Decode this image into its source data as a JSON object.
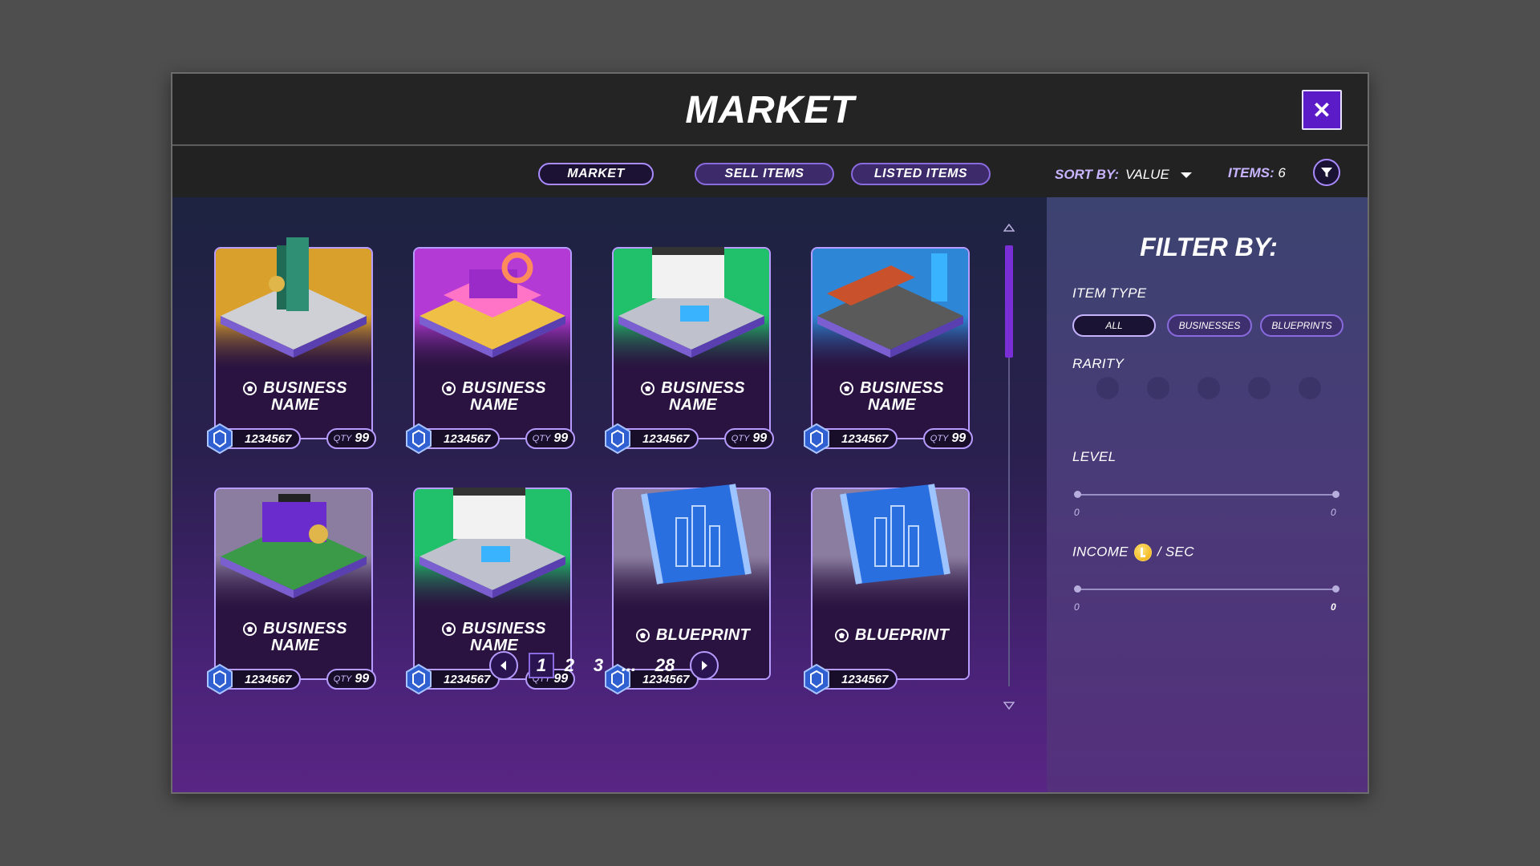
{
  "window": {
    "title": "MARKET",
    "close_label": "✕"
  },
  "tabs": [
    {
      "label": "MARKET",
      "active": true
    },
    {
      "label": "SELL ITEMS",
      "active": false
    },
    {
      "label": "LISTED ITEMS",
      "active": false
    }
  ],
  "sort": {
    "label": "SORT BY:",
    "value": "VALUE"
  },
  "items": {
    "label": "ITEMS:",
    "count": "6"
  },
  "cards": [
    {
      "name_line1": "BUSINESS",
      "name_line2": "NAME",
      "price": "1234567",
      "qty_label": "QTY",
      "qty": "99",
      "bg": "#d9a02b",
      "art": "tower-icon"
    },
    {
      "name_line1": "BUSINESS",
      "name_line2": "NAME",
      "price": "1234567",
      "qty_label": "QTY",
      "qty": "99",
      "bg": "#b43ad6",
      "art": "donuts-diner-icon"
    },
    {
      "name_line1": "BUSINESS",
      "name_line2": "NAME",
      "price": "1234567",
      "qty_label": "QTY",
      "qty": "99",
      "bg": "#21c06a",
      "art": "hotel-icon"
    },
    {
      "name_line1": "BUSINESS",
      "name_line2": "NAME",
      "price": "1234567",
      "qty_label": "QTY",
      "qty": "99",
      "bg": "#2e86d6",
      "art": "motel-icon"
    },
    {
      "name_line1": "BUSINESS",
      "name_line2": "NAME",
      "price": "1234567",
      "qty_label": "QTY",
      "qty": "99",
      "bg": "#8b7da0",
      "art": "gym-icon"
    },
    {
      "name_line1": "BUSINESS",
      "name_line2": "NAME",
      "price": "1234567",
      "qty_label": "QTY",
      "qty": "99",
      "bg": "#21c06a",
      "art": "hotel-icon"
    },
    {
      "name_line1": "BLUEPRINT",
      "name_line2": "",
      "price": "1234567",
      "bg": "#8b7da0",
      "art": "blueprint-icon"
    },
    {
      "name_line1": "BLUEPRINT",
      "name_line2": "",
      "price": "1234567",
      "bg": "#8b7da0",
      "art": "blueprint-icon"
    }
  ],
  "pagination": {
    "pages": [
      "1",
      "2",
      "3",
      "...",
      "28"
    ],
    "current": "1"
  },
  "filter": {
    "title": "FILTER BY:",
    "item_type_label": "ITEM TYPE",
    "item_types": [
      {
        "label": "ALL",
        "active": true
      },
      {
        "label": "BUSINESSES",
        "active": false
      },
      {
        "label": "BLUEPRINTS",
        "active": false
      }
    ],
    "rarity_label": "RARITY",
    "rarity_count": 5,
    "level_label": "LEVEL",
    "level_min": "0",
    "level_max": "0",
    "income_label": "INCOME",
    "income_suffix": "/ SEC",
    "income_min": "0",
    "income_max": "0"
  },
  "colors": {
    "accent": "#5b1cc8",
    "border": "#b79cff"
  }
}
